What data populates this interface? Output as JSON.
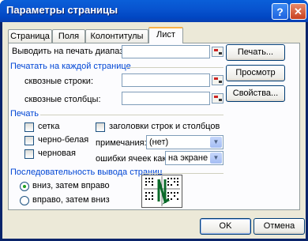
{
  "window": {
    "title": "Параметры страницы",
    "help_glyph": "?",
    "close_glyph": "✕"
  },
  "tabs": [
    "Страница",
    "Поля",
    "Колонтитулы",
    "Лист"
  ],
  "print_area": {
    "label": "Выводить на печать диапазон:",
    "value": ""
  },
  "print_titles": {
    "group_title": "Печатать на каждой странице",
    "rows_label": "сквозные строки:",
    "rows_value": "",
    "cols_label": "сквозные столбцы:",
    "cols_value": ""
  },
  "print": {
    "group_title": "Печать",
    "gridlines": "сетка",
    "black_white": "черно-белая",
    "draft": "черновая",
    "row_col_headings": "заголовки строк и столбцов",
    "comments_label": "примечания:",
    "comments_value": "(нет)",
    "errors_label": "ошибки ячеек как:",
    "errors_value": "на экране"
  },
  "page_order": {
    "group_title": "Последовательность вывода страниц",
    "down_then_over": "вниз, затем вправо",
    "over_then_down": "вправо, затем вниз",
    "selected": "down_then_over"
  },
  "side_buttons": {
    "print": "Печать...",
    "preview": "Просмотр",
    "options": "Свойства..."
  },
  "footer": {
    "ok": "OK",
    "cancel": "Отмена"
  },
  "colors": {
    "accent": "#0046d5",
    "title_bar": "#0054d0"
  }
}
